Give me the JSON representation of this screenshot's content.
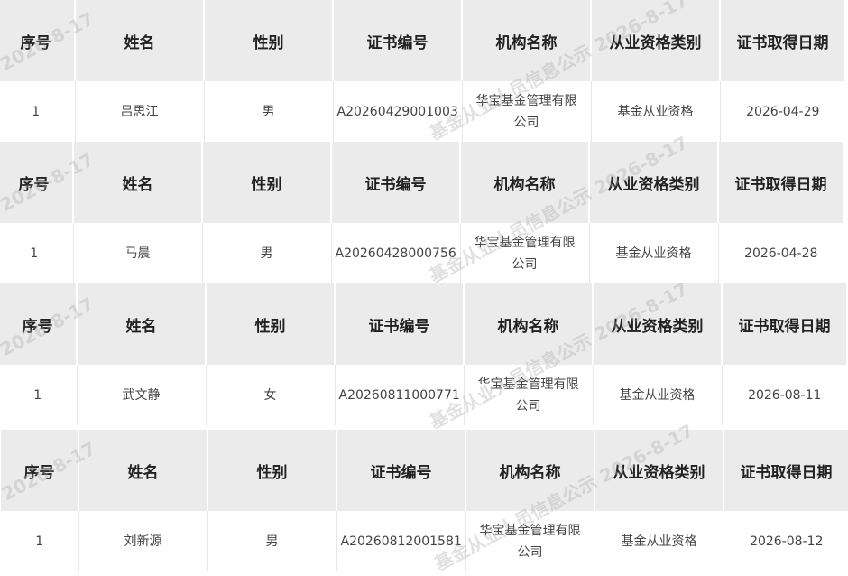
{
  "columns": [
    "序号",
    "姓名",
    "性别",
    "证书编号",
    "机构名称",
    "从业资格类别",
    "证书取得日期"
  ],
  "records": [
    {
      "index": "1",
      "name": "吕思江",
      "gender": "男",
      "cert_no": "A20260429001003",
      "org": "华宝基金管理有限公司",
      "category": "基金从业资格",
      "date": "2026-04-29"
    },
    {
      "index": "1",
      "name": "马晨",
      "gender": "男",
      "cert_no": "A20260428000756",
      "org": "华宝基金管理有限公司",
      "category": "基金从业资格",
      "date": "2026-04-28"
    },
    {
      "index": "1",
      "name": "武文静",
      "gender": "女",
      "cert_no": "A20260811000771",
      "org": "华宝基金管理有限公司",
      "category": "基金从业资格",
      "date": "2026-08-11"
    },
    {
      "index": "1",
      "name": "刘新源",
      "gender": "男",
      "cert_no": "A20260812001581",
      "org": "华宝基金管理有限公司",
      "category": "基金从业资格",
      "date": "2026-08-12"
    }
  ],
  "watermark": {
    "short": "2026-8-17",
    "long": "基金从业人员信息公示 2026-8-17"
  }
}
